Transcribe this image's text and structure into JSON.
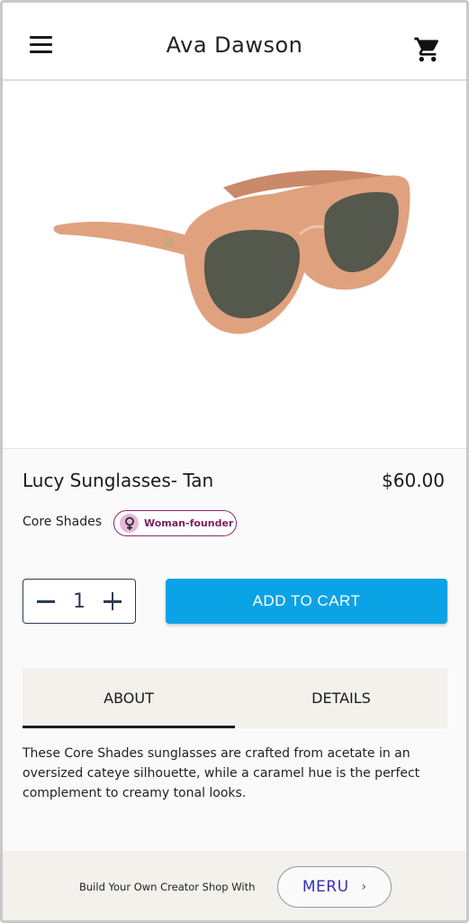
{
  "header": {
    "shop_name": "Ava Dawson",
    "menu_icon": "hamburger-menu-icon",
    "cart_icon": "shopping-cart-icon"
  },
  "product": {
    "name": "Lucy Sunglasses- Tan",
    "price": "$60.00",
    "brand": "Core Shades",
    "badge": "Woman-founder",
    "badge_icon": "female-symbol-icon",
    "frame_color": "#e0a17f",
    "lens_color": "#55584c"
  },
  "quantity": {
    "value": "1"
  },
  "actions": {
    "add_to_cart": "ADD TO CART"
  },
  "tabs": [
    {
      "label": "ABOUT",
      "active": true
    },
    {
      "label": "DETAILS",
      "active": false
    }
  ],
  "description": "These Core Shades sunglasses are crafted from acetate in an oversized cateye silhouette, while a caramel hue is the perfect complement to creamy tonal looks.",
  "footer": {
    "text": "Build Your Own Creator Shop With",
    "brand_button": "MERU",
    "chevron": "›"
  },
  "colors": {
    "accent": "#0aa3e6",
    "badge_border": "#8c2a73",
    "qty_border": "#2b3d55",
    "footer_bg": "#f3f1ec"
  }
}
